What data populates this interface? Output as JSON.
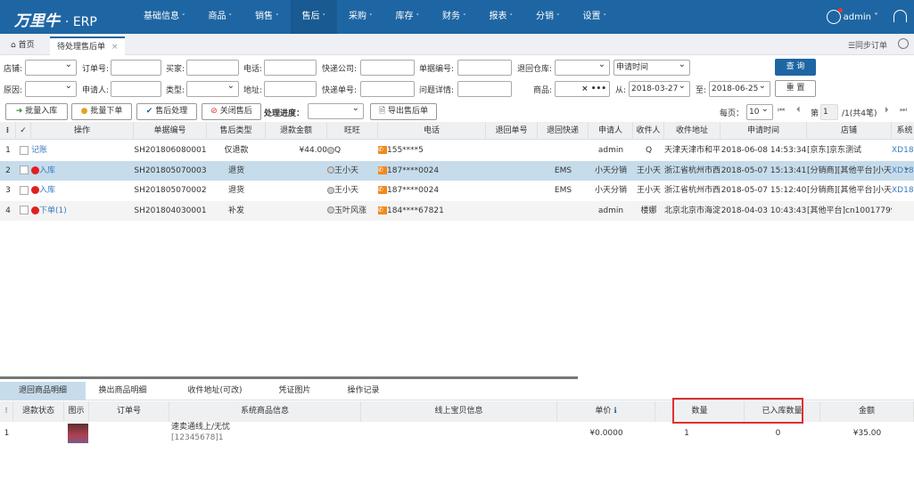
{
  "nav": {
    "logo": "万里牛",
    "logo_suffix": "· ERP",
    "menu": [
      "基础信息",
      "商品",
      "销售",
      "售后",
      "采购",
      "库存",
      "财务",
      "报表",
      "分销",
      "设置"
    ],
    "active": "售后",
    "user": "admin"
  },
  "tabs": {
    "home": "首页",
    "current": "待处理售后单",
    "close": "×",
    "sync": "☰同步订单"
  },
  "filters": {
    "shop": "店铺:",
    "order_no": "订单号:",
    "buyer": "买家:",
    "phone": "电话:",
    "express_co": "快递公司:",
    "doc_no": "单据编号:",
    "return_wh": "退回仓库:",
    "time_type": "申请时间",
    "query": "查 询",
    "reason": "原因:",
    "applicant": "申请人:",
    "type": "类型:",
    "address": "地址:",
    "express_no": "快递单号:",
    "issue": "问题详情:",
    "goods": "商品:",
    "goods_clear": "× •••",
    "from": "从:",
    "from_date": "2018-03-27",
    "to": "至:",
    "to_date": "2018-06-25",
    "reset": "重 置"
  },
  "toolbar": {
    "batch_in": "批量入库",
    "batch_order": "批量下单",
    "process": "售后处理",
    "close": "关闭售后",
    "progress": "处理进度：",
    "export": "导出售后单",
    "per_page_label": "每页：",
    "per_page": "10",
    "page_label": "第",
    "page": "1",
    "page_total": "/1(共4笔)"
  },
  "table": {
    "headers": [
      "⁝",
      "✓",
      "操作",
      "单据编号",
      "售后类型",
      "退款金额",
      "旺旺",
      "电话",
      "退回单号",
      "退回快递",
      "申请人",
      "收件人",
      "收件地址",
      "申请时间",
      "店铺",
      "系统"
    ],
    "rows": [
      {
        "idx": "1",
        "action": "记账",
        "alarm": false,
        "doc": "SH201806080001",
        "type": "仅退款",
        "refund": "¥44.00",
        "ww": "Q",
        "phone": "155****5",
        "ret_no": "",
        "ret_exp": "",
        "applicant": "admin",
        "receiver": "Q",
        "addr": "天津天津市和平",
        "time": "2018-06-08 14:53:34",
        "shop": "[京东]京东测试",
        "sys": "XD18"
      },
      {
        "idx": "2",
        "action": "入库",
        "alarm": true,
        "doc": "SH201805070003",
        "type": "退货",
        "refund": "",
        "ww": "王小天",
        "phone": "187****0024",
        "ret_no": "",
        "ret_exp": "EMS",
        "applicant": "小天分销",
        "receiver": "王小天",
        "addr": "浙江省杭州市西",
        "time": "2018-05-07 15:13:41",
        "shop": "[分销商][其他平台]小天分",
        "sys": "XD18"
      },
      {
        "idx": "3",
        "action": "入库",
        "alarm": true,
        "doc": "SH201805070002",
        "type": "退货",
        "refund": "",
        "ww": "王小天",
        "phone": "187****0024",
        "ret_no": "",
        "ret_exp": "EMS",
        "applicant": "小天分销",
        "receiver": "王小天",
        "addr": "浙江省杭州市西",
        "time": "2018-05-07 15:12:40",
        "shop": "[分销商][其他平台]小天分",
        "sys": "XD18"
      },
      {
        "idx": "4",
        "action": "下单(1)",
        "alarm": true,
        "doc": "SH201804030001",
        "type": "补发",
        "refund": "",
        "ww": "玉叶风涨",
        "phone": "184****67821",
        "ret_no": "",
        "ret_exp": "",
        "applicant": "admin",
        "receiver": "楼娜",
        "addr": "北京北京市海淀",
        "time": "2018-04-03 10:43:43",
        "shop": "[其他平台]cn10017799",
        "sys": ""
      }
    ]
  },
  "bottom": {
    "tabs": [
      "退回商品明细",
      "换出商品明细",
      "收件地址(可改)",
      "凭证图片",
      "操作记录"
    ],
    "headers": [
      "⁝",
      "退款状态",
      "图示",
      "订单号",
      "系统商品信息",
      "线上宝贝信息",
      "单价",
      "数量",
      "已入库数量",
      "金额"
    ],
    "row": {
      "idx": "1",
      "goods": "速卖通线上/无忧",
      "sku": "[12345678]1",
      "price": "¥0.0000",
      "qty": "1",
      "in_qty": "0",
      "amount": "¥35.00"
    }
  },
  "colors": {
    "nav": "#1e66a3",
    "selected_row": "#c6dceb",
    "highlight_box": "#e03030"
  }
}
